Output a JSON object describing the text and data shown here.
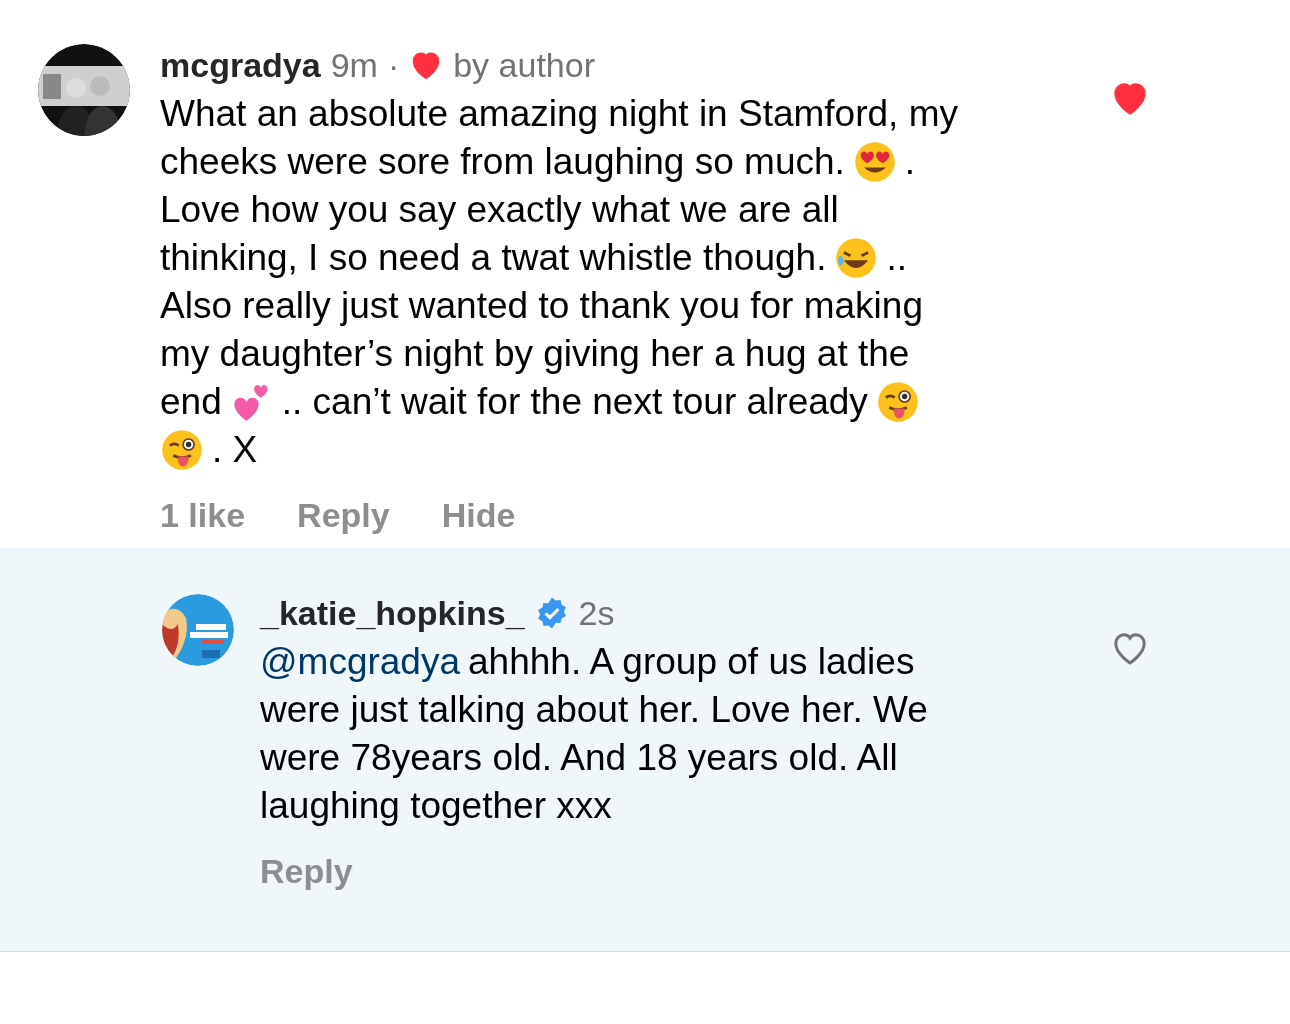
{
  "comment": {
    "username": "mcgradya",
    "time": "9m",
    "separator": "·",
    "liked_by_author": true,
    "author_label": "by author",
    "liked": true,
    "lines": [
      [
        {
          "kind": "text",
          "text": "What an absolute amazing night in Stamford, my"
        }
      ],
      [
        {
          "kind": "text",
          "text": "cheeks were sore from laughing so much."
        },
        {
          "kind": "heart-eyes"
        },
        {
          "kind": "text",
          "text": "."
        }
      ],
      [
        {
          "kind": "text",
          "text": "Love how you say exactly what we are all"
        }
      ],
      [
        {
          "kind": "text",
          "text": "thinking, I so need a twat whistle though."
        },
        {
          "kind": "laughing"
        },
        {
          "kind": "text",
          "text": ".."
        }
      ],
      [
        {
          "kind": "text",
          "text": "Also really just wanted to thank you for making"
        }
      ],
      [
        {
          "kind": "text",
          "text": "my daughter’s night by giving her a hug at the"
        }
      ],
      [
        {
          "kind": "text",
          "text": "end"
        },
        {
          "kind": "hearts"
        },
        {
          "kind": "text",
          "text": ".. can’t wait for the next tour already"
        },
        {
          "kind": "wink-tongue"
        }
      ],
      [
        {
          "kind": "wink-tongue"
        },
        {
          "kind": "text",
          "text": ". X"
        }
      ]
    ],
    "actions": [
      "1 like",
      "Reply",
      "Hide"
    ]
  },
  "reply": {
    "username": "_katie_hopkins_",
    "verified": true,
    "time": "2s",
    "liked": false,
    "mention": "@mcgradya",
    "lines": [
      "ahhhh. A group of us ladies",
      "were just talking about her. Love her. We",
      "were 78years old. And 18 years old. All",
      "laughing together xxx"
    ],
    "actions": [
      "Reply"
    ]
  }
}
